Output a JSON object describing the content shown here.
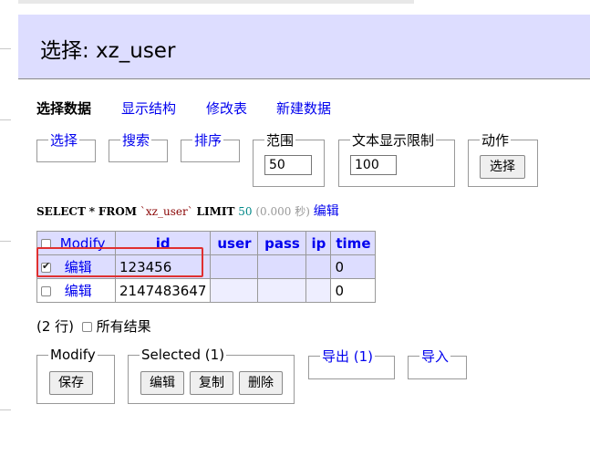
{
  "title": "选择: xz_user",
  "tabs": [
    {
      "label": "选择数据"
    },
    {
      "label": "显示结构"
    },
    {
      "label": "修改表"
    },
    {
      "label": "新建数据"
    }
  ],
  "filters": {
    "select_label": "选择",
    "search_label": "搜索",
    "sort_label": "排序",
    "range_label": "范围",
    "range_value": "50",
    "text_limit_label": "文本显示限制",
    "text_limit_value": "100",
    "action_label": "动作",
    "select_button": "选择"
  },
  "query": {
    "select": "SELECT",
    "star": "*",
    "from": "FROM",
    "table": "`xz_user`",
    "limit": "LIMIT",
    "limit_value": "50",
    "time": "(0.000 秒)",
    "edit": "编辑"
  },
  "table": {
    "columns": [
      "Modify",
      "id",
      "user",
      "pass",
      "ip",
      "time"
    ],
    "rows": [
      {
        "checked": true,
        "edit": "编辑",
        "id": "123456",
        "user": "",
        "pass": "",
        "ip": "",
        "time": "0"
      },
      {
        "checked": false,
        "edit": "编辑",
        "id": "2147483647",
        "user": "",
        "pass": "",
        "ip": "",
        "time": "0"
      }
    ]
  },
  "summary": {
    "row_count": "(2 行)",
    "all_results": "所有结果"
  },
  "actions": {
    "modify_legend": "Modify",
    "save_button": "保存",
    "selected_legend": "Selected (1)",
    "edit_button": "编辑",
    "copy_button": "复制",
    "delete_button": "删除",
    "export_legend": "导出 (1)",
    "import_legend": "导入"
  }
}
